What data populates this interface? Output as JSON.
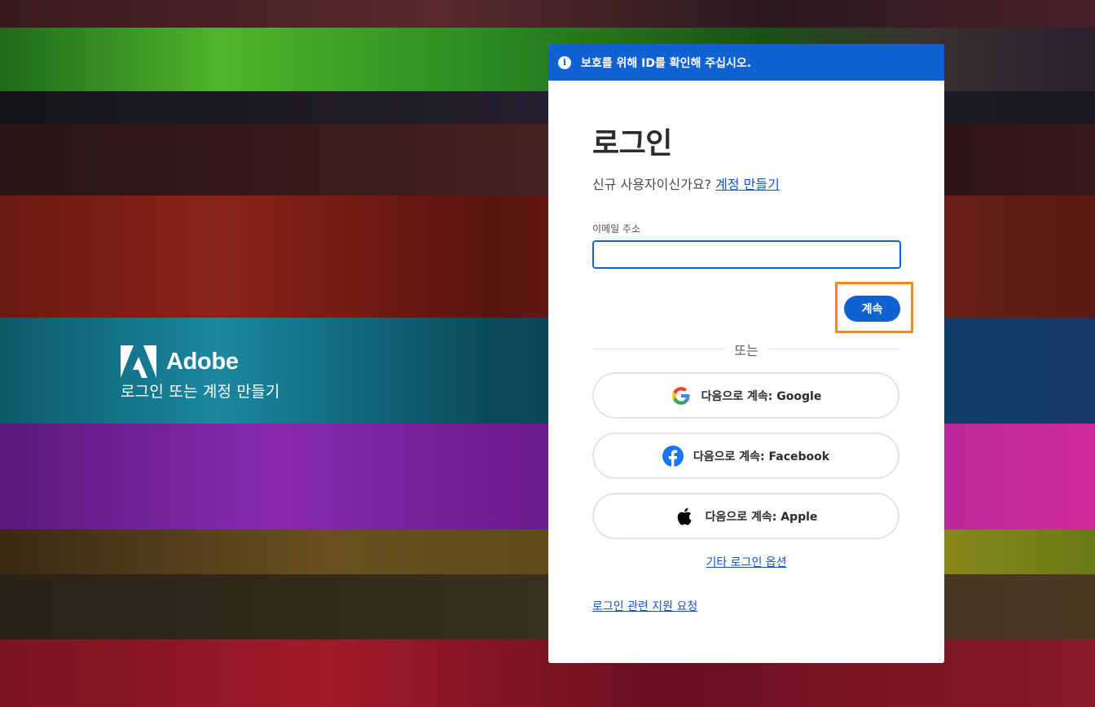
{
  "brand": {
    "name": "Adobe",
    "tagline": "로그인 또는 계정 만들기"
  },
  "banner": {
    "text": "보호를 위해 ID를 확인해 주십시오."
  },
  "signin": {
    "title": "로그인",
    "new_user_prompt": "신규 사용자이신가요?",
    "create_account_link": "계정 만들기",
    "email_label": "이메일 주소",
    "email_value": "",
    "continue_label": "계속",
    "divider_text": "또는",
    "social": {
      "google": "다음으로 계속: Google",
      "facebook": "다음으로 계속: Facebook",
      "apple": "다음으로 계속: Apple"
    },
    "other_options_link": "기타 로그인 옵션",
    "support_link": "로그인 관련 지원 요청"
  },
  "colors": {
    "accent": "#1062d2",
    "highlight": "#f08a27"
  },
  "icons": {
    "banner": "info-icon",
    "google": "google-icon",
    "facebook": "facebook-icon",
    "apple": "apple-icon",
    "brand": "adobe-logo-icon"
  }
}
